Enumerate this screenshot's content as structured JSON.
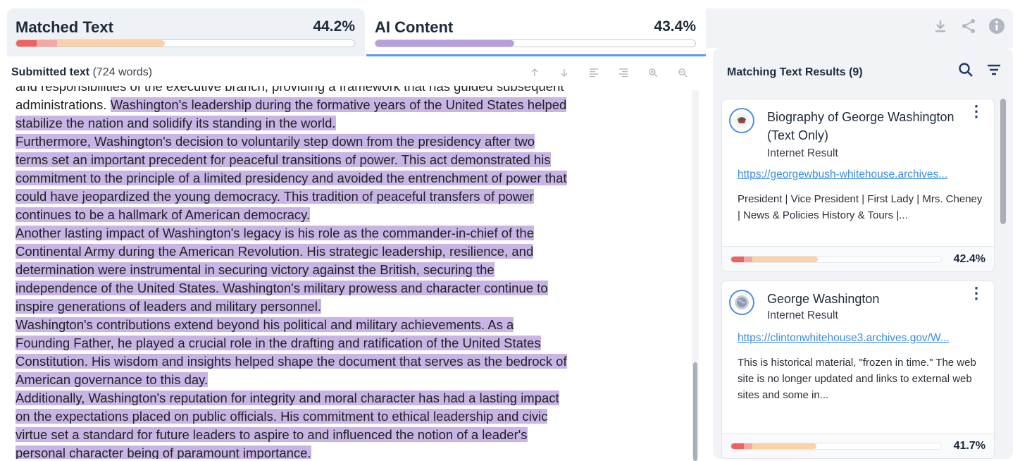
{
  "tabs": {
    "matched": {
      "label": "Matched Text",
      "percent": "44.2%",
      "segments": [
        {
          "color": "#f0625d",
          "width": 0.06
        },
        {
          "color": "#f7a7a3",
          "width": 0.06
        },
        {
          "color": "#fbd2a8",
          "width": 0.32
        }
      ]
    },
    "ai": {
      "label": "AI Content",
      "percent": "43.4%",
      "segments": [
        {
          "color": "#b79fdc",
          "width": 0.434
        }
      ]
    }
  },
  "submitted": {
    "label": "Submitted text",
    "words": "(724 words)"
  },
  "toolbar": {
    "icons": [
      "arrow-up-icon",
      "arrow-down-icon",
      "align-left-icon",
      "align-right-icon",
      "zoom-in-icon",
      "zoom-out-icon"
    ]
  },
  "text": {
    "lines": [
      {
        "pre": "and responsibilities of the executive branch, providing a framework that has guided subsequent",
        "hl": ""
      },
      {
        "pre": "administrations. ",
        "hl": "Washington's leadership during the formative years of the United States helped"
      },
      {
        "pre": "",
        "hl": "stabilize the nation and solidify its standing in the world."
      },
      {
        "pre": "",
        "hl": "Furthermore, Washington's decision to voluntarily step down from the presidency after two"
      },
      {
        "pre": "",
        "hl": "terms set an important precedent for peaceful transitions of power. This act demonstrated his"
      },
      {
        "pre": "",
        "hl": "commitment to the principle of a limited presidency and avoided the entrenchment of power that"
      },
      {
        "pre": "",
        "hl": "could have jeopardized the young democracy. This tradition of peaceful transfers of power"
      },
      {
        "pre": "",
        "hl": "continues to be a hallmark of American democracy."
      },
      {
        "pre": "",
        "hl": "Another lasting impact of Washington's legacy is his role as the commander-in-chief of the"
      },
      {
        "pre": "",
        "hl": "Continental Army during the American Revolution. His strategic leadership, resilience, and"
      },
      {
        "pre": "",
        "hl": "determination were instrumental in securing victory against the British, securing the"
      },
      {
        "pre": "",
        "hl": "independence of the United States. Washington's military prowess and character continue to"
      },
      {
        "pre": "",
        "hl": "inspire generations of leaders and military personnel."
      },
      {
        "pre": "",
        "hl": "Washington's contributions extend beyond his political and military achievements. As a"
      },
      {
        "pre": "",
        "hl": "Founding Father, he played a crucial role in the drafting and ratification of the United States"
      },
      {
        "pre": "",
        "hl": "Constitution. His wisdom and insights helped shape the document that serves as the bedrock of"
      },
      {
        "pre": "",
        "hl": "American governance to this day."
      },
      {
        "pre": "",
        "hl": "Additionally, Washington's reputation for integrity and moral character has had a lasting impact"
      },
      {
        "pre": "",
        "hl": "on the expectations placed on public officials. His commitment to ethical leadership and civic"
      },
      {
        "pre": "",
        "hl": "virtue set a standard for future leaders to aspire to and influenced the notion of a leader's"
      },
      {
        "pre": "",
        "hl": "personal character being of paramount importance."
      }
    ]
  },
  "top_icons": [
    "download-icon",
    "share-icon",
    "info-icon"
  ],
  "results": {
    "title": "Matching Text Results (9)",
    "items": [
      {
        "title": "Biography of George Washington (Text Only)",
        "type": "Internet Result",
        "link": "https://georgewbush-whitehouse.archives...",
        "desc": "President | Vice President | First Lady | Mrs. Cheney | News & Policies History & Tours |...",
        "percent": "42.4%",
        "segments": [
          {
            "color": "#f0625d",
            "width": 0.06
          },
          {
            "color": "#f7a7a3",
            "width": 0.04
          },
          {
            "color": "#fbd2a8",
            "width": 0.314
          }
        ]
      },
      {
        "title": "George Washington",
        "type": "Internet Result",
        "link": "https://clintonwhitehouse3.archives.gov/W...",
        "desc": "This is historical material, \"frozen in time.\" The web site is no longer updated and links to external web sites and some in...",
        "percent": "41.7%",
        "segments": [
          {
            "color": "#f0625d",
            "width": 0.06
          },
          {
            "color": "#f7a7a3",
            "width": 0.04
          },
          {
            "color": "#fbd2a8",
            "width": 0.307
          }
        ]
      }
    ]
  }
}
